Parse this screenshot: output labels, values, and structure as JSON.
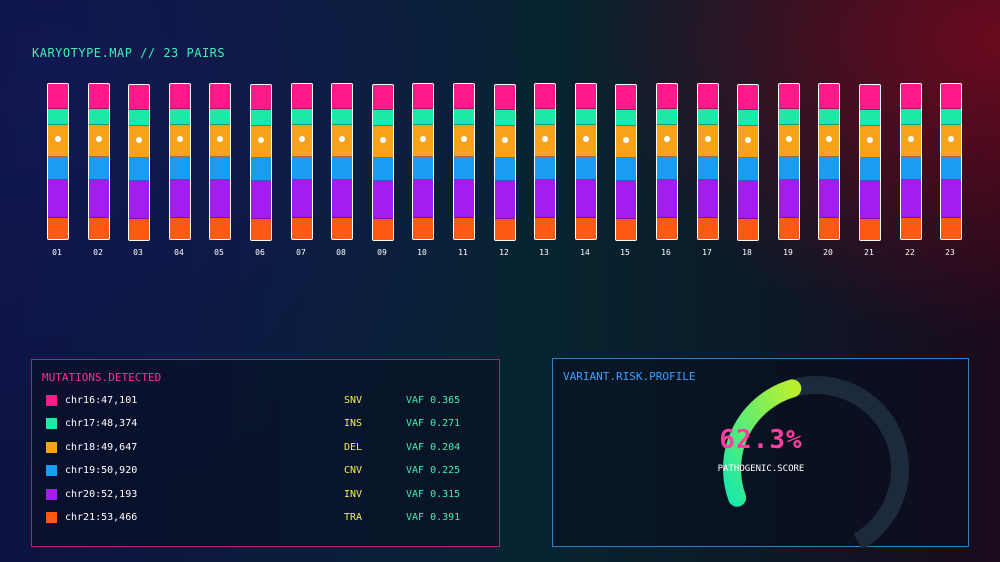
{
  "karyotype": {
    "title": "KARYOTYPE.MAP // 23 PAIRS",
    "band_colors": [
      "#ff1a8c",
      "#1de9a6",
      "#f7a21b",
      "#1a9cf0",
      "#a11df0",
      "#ff5a14"
    ],
    "chromosomes": [
      "01",
      "02",
      "03",
      "04",
      "05",
      "06",
      "07",
      "08",
      "09",
      "10",
      "11",
      "12",
      "13",
      "14",
      "15",
      "16",
      "17",
      "18",
      "19",
      "20",
      "21",
      "22",
      "23"
    ]
  },
  "mutations": {
    "title": "MUTATIONS.DETECTED",
    "rows": [
      {
        "color": "#ff1a8c",
        "locus": "chr16:47,101",
        "type": "SNV",
        "vaf": "VAF 0.365"
      },
      {
        "color": "#1de9a6",
        "locus": "chr17:48,374",
        "type": "INS",
        "vaf": "VAF 0.271"
      },
      {
        "color": "#f7a21b",
        "locus": "chr18:49,647",
        "type": "DEL",
        "vaf": "VAF 0.204"
      },
      {
        "color": "#1a9cf0",
        "locus": "chr19:50,920",
        "type": "CNV",
        "vaf": "VAF 0.225"
      },
      {
        "color": "#a11df0",
        "locus": "chr20:52,193",
        "type": "INV",
        "vaf": "VAF 0.315"
      },
      {
        "color": "#ff5a14",
        "locus": "chr21:53,466",
        "type": "TRA",
        "vaf": "VAF 0.391"
      }
    ]
  },
  "risk": {
    "title": "VARIANT.RISK.PROFILE",
    "score": "62.3%",
    "score_fraction": 0.623,
    "score_label": "PATHOGENIC.SCORE",
    "gauge_start_color": "#1de9a6",
    "gauge_end_color": "#b8f030",
    "track_color": "#1c2a3c"
  }
}
